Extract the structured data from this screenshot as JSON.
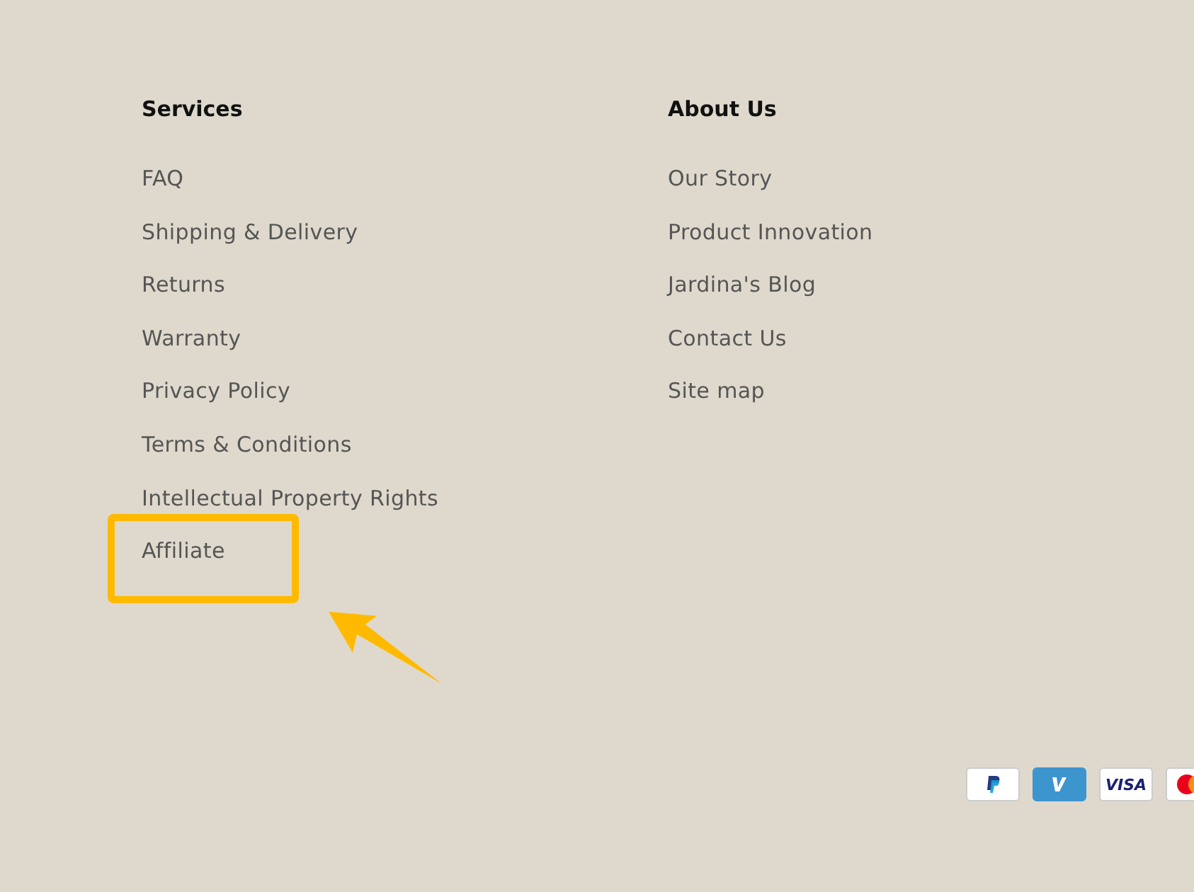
{
  "columns": [
    {
      "heading": "Services",
      "links": [
        {
          "text": "FAQ",
          "highlighted": false
        },
        {
          "text": "Shipping & Delivery",
          "highlighted": false
        },
        {
          "text": "Returns",
          "highlighted": false
        },
        {
          "text": "Warranty",
          "highlighted": false
        },
        {
          "text": "Privacy Policy",
          "highlighted": false
        },
        {
          "text": "Terms & Conditions",
          "highlighted": false
        },
        {
          "text": "Intellectual Property Rights",
          "highlighted": false
        },
        {
          "text": "Affiliate",
          "highlighted": true
        }
      ]
    },
    {
      "heading": "About Us",
      "links": [
        {
          "text": "Our Story",
          "highlighted": false
        },
        {
          "text": "Product Innovation",
          "highlighted": false
        },
        {
          "text": "Jardina's Blog",
          "highlighted": false
        },
        {
          "text": "Contact Us",
          "highlighted": false
        },
        {
          "text": "Site map",
          "highlighted": false
        }
      ]
    }
  ],
  "payment_icons": [
    {
      "kind": "paypal"
    },
    {
      "kind": "venmo"
    },
    {
      "kind": "visa",
      "label": "VISA"
    },
    {
      "kind": "mastercard"
    }
  ]
}
